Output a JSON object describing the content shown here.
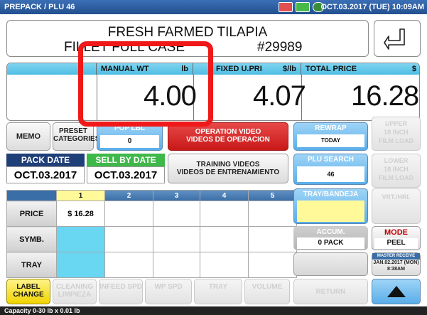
{
  "topbar": {
    "title": "PREPACK / PLU 46",
    "datetime": "OCT.03.2017 (TUE) 10:09AM"
  },
  "product": {
    "name_line1": "FRESH FARMED TILAPIA",
    "name_line2": "FILLET FULL CASE",
    "plu_number": "#29989"
  },
  "values": {
    "manual_wt": {
      "label": "MANUAL WT",
      "unit": "lb",
      "value": "4.00"
    },
    "fixed_upri": {
      "label": "FIXED U.PRI",
      "unit": "$/lb",
      "value": "4.07"
    },
    "total_price": {
      "label": "TOTAL PRICE",
      "unit": "$",
      "value": "16.28"
    }
  },
  "buttons": {
    "memo": "MEMO",
    "preset_categories_1": "PRESET",
    "preset_categories_2": "CATEGORIES",
    "pop_lbl": "POP LBL",
    "pop_lbl_value": "0",
    "operation_video_1": "OPERATION VIDEO",
    "operation_video_2": "VIDEOS DE OPERACION",
    "rewrap": "REWRAP",
    "rewrap_sub": "TODAY",
    "upper_film_1": "UPPER",
    "upper_film_2": "18 INCH",
    "upper_film_3": "FILM LOAD",
    "training_video_1": "TRAINING VIDEOS",
    "training_video_2": "VIDEOS DE ENTRENAMIENTO",
    "plu_search": "PLU SEARCH",
    "plu_search_value": "46",
    "lower_film_1": "LOWER",
    "lower_film_2": "18 INCH",
    "lower_film_3": "FILM LOAD",
    "tray_bandeja": "TRAY/BANDEJA",
    "vrt_hri": "VRT./HRI.",
    "accum": "ACCUM.",
    "accum_value": "0 PACK",
    "mode": "MODE",
    "mode_value": "PEEL",
    "master_receive": "MASTER RECEIVE",
    "master_date": "JAN.02.2017 (MON)",
    "master_time": "8:38AM",
    "label_change_1": "LABEL",
    "label_change_2": "CHANGE",
    "cleaning_1": "CLEANING",
    "cleaning_2": "LIMPIEZA",
    "infeed_spd": "INFEED SPD",
    "wp_spd": "WP SPD",
    "tray": "TRAY",
    "volume": "VOLUME",
    "return": "RETURN"
  },
  "dates": {
    "pack_date_label": "PACK DATE",
    "pack_date": "OCT.03.2017",
    "sell_by_label": "SELL BY DATE",
    "sell_by": "OCT.03.2017"
  },
  "grid": {
    "columns": [
      "1",
      "2",
      "3",
      "4",
      "5"
    ],
    "rows": [
      {
        "label": "PRICE",
        "cells": [
          "$ 16.28",
          "",
          "",
          "",
          ""
        ]
      },
      {
        "label": "SYMB.",
        "cells": [
          "",
          "",
          "",
          "",
          ""
        ]
      },
      {
        "label": "TRAY",
        "cells": [
          "",
          "",
          "",
          "",
          ""
        ]
      }
    ]
  },
  "footer": {
    "capacity": "Capacity 0-30 lb x 0.01 lb"
  },
  "colors": {
    "header_blue": "#2f5fa3",
    "accent_cyan": "#4fbde3",
    "alert_red": "#f01818",
    "tray_yellow": "#fff99a"
  }
}
